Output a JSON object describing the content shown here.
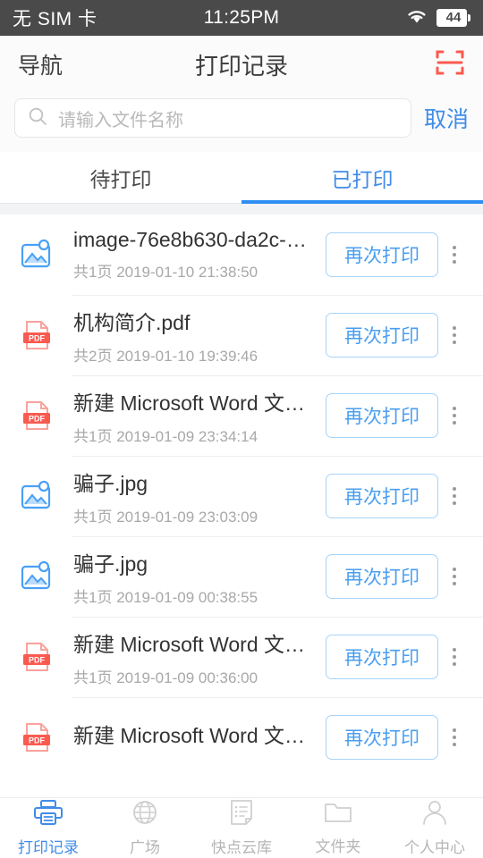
{
  "statusbar": {
    "carrier": "无 SIM 卡",
    "time": "11:25PM",
    "wifi_icon": "wifi-icon",
    "battery_level": "44"
  },
  "header": {
    "back_label": "导航",
    "title": "打印记录",
    "scan_icon": "scan-icon",
    "scan_color": "#fa5a50"
  },
  "search": {
    "placeholder": "请输入文件名称",
    "value": "",
    "search_icon": "search-icon",
    "cancel_label": "取消",
    "cancel_color": "#3f8ce8"
  },
  "tabs": {
    "items": [
      {
        "label": "待打印",
        "active": false
      },
      {
        "label": "已打印",
        "active": true
      }
    ],
    "active_color": "#2f8ef4"
  },
  "list": {
    "reprint_label": "再次打印",
    "more_icon": "more-vertical-icon",
    "items": [
      {
        "file_type": "image",
        "icon": "image-file-icon",
        "title": "image-76e8b630-da2c-4…",
        "pages": "共1页",
        "timestamp": "2019-01-10 21:38:50"
      },
      {
        "file_type": "pdf",
        "icon": "pdf-file-icon",
        "title": "机构简介.pdf",
        "pages": "共2页",
        "timestamp": "2019-01-10 19:39:46"
      },
      {
        "file_type": "pdf",
        "icon": "pdf-file-icon",
        "title": "新建 Microsoft Word 文档…",
        "pages": "共1页",
        "timestamp": "2019-01-09 23:34:14"
      },
      {
        "file_type": "image",
        "icon": "image-file-icon",
        "title": "骗子.jpg",
        "pages": "共1页",
        "timestamp": "2019-01-09 23:03:09"
      },
      {
        "file_type": "image",
        "icon": "image-file-icon",
        "title": "骗子.jpg",
        "pages": "共1页",
        "timestamp": "2019-01-09 00:38:55"
      },
      {
        "file_type": "pdf",
        "icon": "pdf-file-icon",
        "title": "新建 Microsoft Word 文档…",
        "pages": "共1页",
        "timestamp": "2019-01-09 00:36:00"
      },
      {
        "file_type": "pdf",
        "icon": "pdf-file-icon",
        "title": "新建 Microsoft Word 文档…",
        "pages": "",
        "timestamp": ""
      }
    ]
  },
  "bottomnav": {
    "items": [
      {
        "label": "打印记录",
        "icon": "printer-icon",
        "active": true
      },
      {
        "label": "广场",
        "icon": "globe-icon",
        "active": false
      },
      {
        "label": "快点云库",
        "icon": "document-list-icon",
        "active": false
      },
      {
        "label": "文件夹",
        "icon": "folder-icon",
        "active": false
      },
      {
        "label": "个人中心",
        "icon": "person-icon",
        "active": false
      }
    ],
    "active_color": "#3f8ce8",
    "inactive_color": "#b5b5b5"
  }
}
